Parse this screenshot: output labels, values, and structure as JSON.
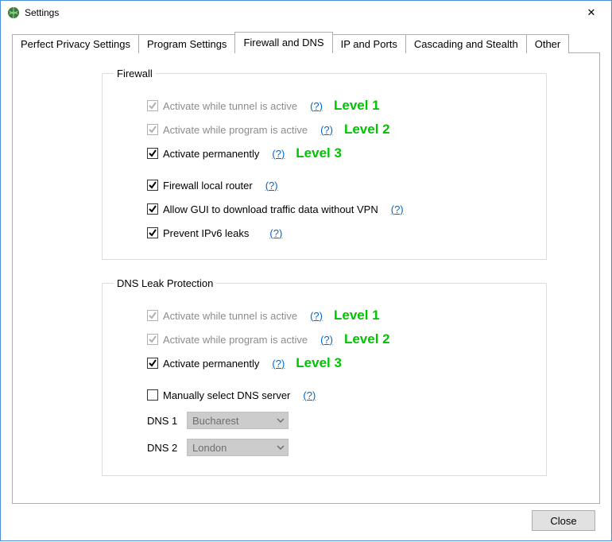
{
  "window": {
    "title": "Settings",
    "close_label": "✕"
  },
  "tabs": [
    {
      "label": "Perfect Privacy Settings",
      "active": false
    },
    {
      "label": "Program Settings",
      "active": false
    },
    {
      "label": "Firewall and DNS",
      "active": true
    },
    {
      "label": "IP and Ports",
      "active": false
    },
    {
      "label": "Cascading and Stealth",
      "active": false
    },
    {
      "label": "Other",
      "active": false
    }
  ],
  "help_label": "(?)",
  "firewall": {
    "legend": "Firewall",
    "items": [
      {
        "label": "Activate while tunnel is active",
        "checked": true,
        "disabled": true,
        "annot": "Level 1"
      },
      {
        "label": "Activate while program is active",
        "checked": true,
        "disabled": true,
        "annot": "Level 2"
      },
      {
        "label": "Activate permanently",
        "checked": true,
        "disabled": false,
        "annot": "Level 3"
      }
    ],
    "extra": [
      {
        "label": "Firewall local router",
        "checked": true,
        "disabled": false
      },
      {
        "label": "Allow GUI to download traffic data without VPN",
        "checked": true,
        "disabled": false
      },
      {
        "label": "Prevent IPv6 leaks",
        "checked": true,
        "disabled": false
      }
    ]
  },
  "dns": {
    "legend": "DNS Leak Protection",
    "items": [
      {
        "label": "Activate while tunnel is active",
        "checked": true,
        "disabled": true,
        "annot": "Level 1"
      },
      {
        "label": "Activate while program is active",
        "checked": true,
        "disabled": true,
        "annot": "Level 2"
      },
      {
        "label": "Activate permanently",
        "checked": true,
        "disabled": false,
        "annot": "Level 3"
      }
    ],
    "manual": {
      "label": "Manually select DNS server",
      "checked": false,
      "disabled": false
    },
    "servers": [
      {
        "name": "DNS 1",
        "value": "Bucharest"
      },
      {
        "name": "DNS 2",
        "value": "London"
      }
    ]
  },
  "footer": {
    "close": "Close"
  }
}
